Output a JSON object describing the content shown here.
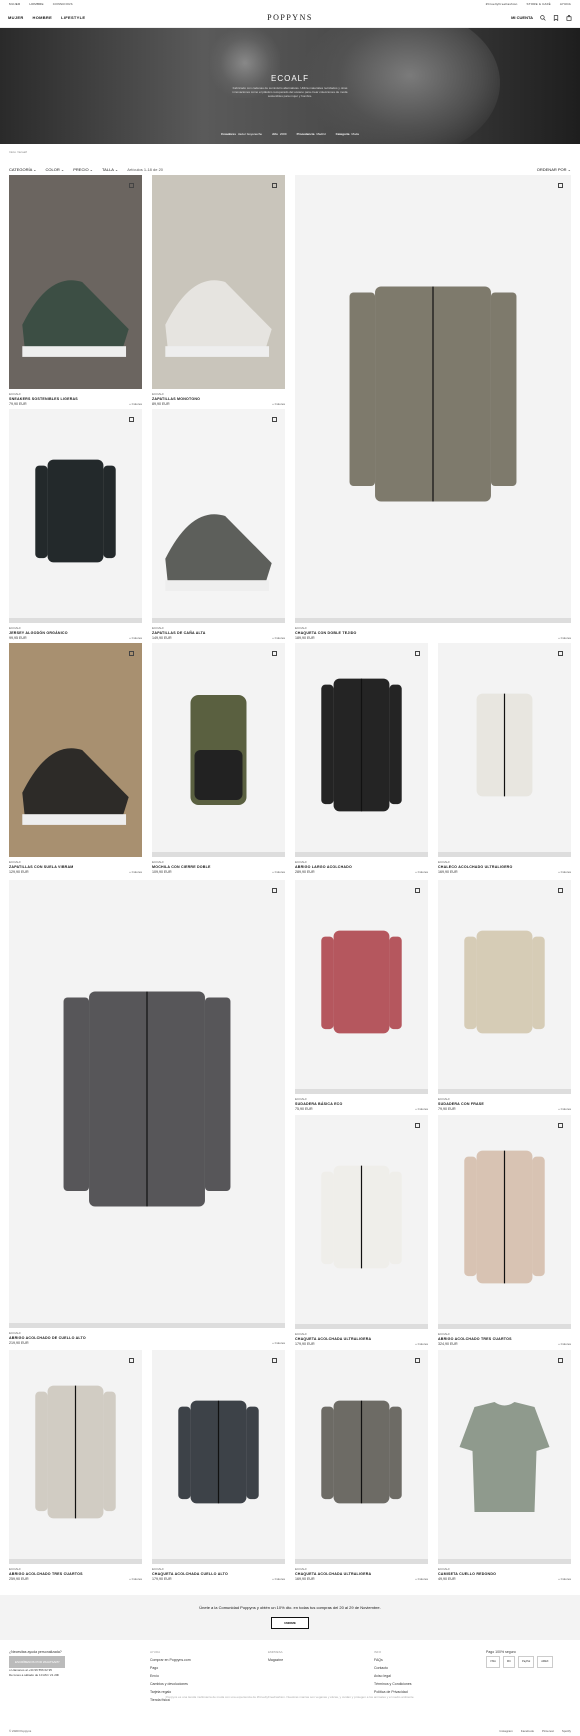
{
  "topbar": {
    "left": [
      "MUJER",
      "HOMBRE",
      "CONSCIOUS"
    ],
    "right": [
      "#CrueltyFreeFashion",
      "STORE & CAFÉ",
      "AYUDA"
    ]
  },
  "header": {
    "logo": "POPPYNS",
    "nav": [
      "MUJER",
      "HOMBRE",
      "LIFESTYLE"
    ],
    "account": "MI CUENTA"
  },
  "hero": {
    "title": "ECOALF",
    "text": "Fabricado con cadenas de suministro alternativas. Utiliza materiales reciclados y otras innovaciones como el plástico recuperado del océano para crear colecciones de moda sostenibles para mujer y hombre.",
    "meta": [
      {
        "k": "Creadores",
        "v": "Javier Goyeneche"
      },
      {
        "k": "Año",
        "v": "2009"
      },
      {
        "k": "Procedencia",
        "v": "Madrid"
      },
      {
        "k": "Categoría",
        "v": "Moda"
      }
    ]
  },
  "breadcrumb": "Inicio / Ecoalf",
  "filters": {
    "items": [
      "CATEGORÍA",
      "COLOR",
      "PRECIO",
      "TALLA"
    ],
    "count": "Artículos 1-18 de 20",
    "sort": "ORDENAR POR"
  },
  "products": [
    {
      "brand": "ECOALF",
      "name": "SNEAKERS SOSTENIBLES LIGERAS",
      "price": "79,90 EUR",
      "colors": "+ Colores"
    },
    {
      "brand": "ECOALF",
      "name": "ZAPATILLAS MONOTONO",
      "price": "89,90 EUR",
      "colors": "+ Colores"
    },
    {
      "brand": "ECOALF",
      "name": "CHAQUETA CON DOBLE TEJIDO",
      "price": "189,90 EUR",
      "colors": "+ Colores"
    },
    {
      "brand": "ECOALF",
      "name": "JERSEY ALGODÓN ORGÁNICO",
      "price": "99,95 EUR",
      "colors": "+ Colores"
    },
    {
      "brand": "ECOALF",
      "name": "ZAPATILLAS DE CAÑA ALTA",
      "price": "149,90 EUR",
      "colors": "+ Colores"
    },
    {
      "brand": "ECOALF",
      "name": "ZAPATILLAS CON SUELA VIBRAM",
      "price": "129,90 EUR",
      "colors": "+ Colores"
    },
    {
      "brand": "ECOALF",
      "name": "MOCHILA CON CIERRE DOBLE",
      "price": "109,90 EUR",
      "colors": "+ Colores"
    },
    {
      "brand": "ECOALF",
      "name": "ABRIGO LARGO ACOLCHADO",
      "price": "289,90 EUR",
      "colors": "+ Colores"
    },
    {
      "brand": "ECOALF",
      "name": "CHALECO ACOLCHADO ULTRALIGERO",
      "price": "169,90 EUR",
      "colors": "+ Colores"
    },
    {
      "brand": "ECOALF",
      "name": "ABRIGO ACOLCHADO DE CUELLO ALTO",
      "price": "219,90 EUR",
      "colors": "+ Colores"
    },
    {
      "brand": "ECOALF",
      "name": "SUDADERA BÁSICA ECO",
      "price": "75,90 EUR",
      "colors": "+ Colores"
    },
    {
      "brand": "ECOALF",
      "name": "SUDADERA CON FRASE",
      "price": "79,90 EUR",
      "colors": "+ Colores"
    },
    {
      "brand": "ECOALF",
      "name": "CHAQUETA ACOLCHADA ULTRALIGERA",
      "price": "179,90 EUR",
      "colors": "+ Colores"
    },
    {
      "brand": "ECOALF",
      "name": "ABRIGO ACOLCHADO TRES CUARTOS",
      "price": "324,90 EUR",
      "colors": "+ Colores"
    },
    {
      "brand": "ECOALF",
      "name": "ABRIGO ACOLCHADO TRES CUARTOS",
      "price": "259,90 EUR",
      "colors": "+ Colores"
    },
    {
      "brand": "ECOALF",
      "name": "CHAQUETA ACOLCHADA CUELLO ALTO",
      "price": "179,90 EUR",
      "colors": "+ Colores"
    },
    {
      "brand": "ECOALF",
      "name": "CHAQUETA ACOLCHADA ULTRALIGERA",
      "price": "169,90 EUR",
      "colors": "+ Colores"
    },
    {
      "brand": "ECOALF",
      "name": "CAMISETA CUELLO REDONDO",
      "price": "49,90 EUR",
      "colors": "+ Colores"
    }
  ],
  "newsletter": {
    "text": "Únete a la Comunidad Poppyns y obtén un 10% dto. en todas tus compras del 20 al 29 de Noviembre.",
    "button": "UNIRME"
  },
  "footer": {
    "help_title": "¿Necesitas ayuda personalizada?",
    "contact_button": "ESCRÍBENOS POR WHATSAPP",
    "phone": "o Llámanos al +34 96 556 02 95",
    "hours": "De lunes a sábado de 10 AM / 21 20h",
    "col1_title": "AYUDA",
    "col1": [
      "Comprar en Poppyns.com",
      "Pago",
      "Envío",
      "Cambios y devoluciones",
      "Tarjeta regalo",
      "Tienda física"
    ],
    "col2_title": "EMPRESA",
    "col2": [
      "Magazine"
    ],
    "col3_title": "INFO",
    "col3": [
      "FAQs",
      "Contacto",
      "Aviso legal",
      "Términos y Condiciones",
      "Política de Privacidad"
    ],
    "pay_title": "Pago 100% seguro",
    "pay": [
      "VISA",
      "MC",
      "PayPal",
      "AMEX"
    ],
    "note": "Poppyns es una tienda multimarca de moda con una experiencia de #CrueltyFreeFashion. Nuestras marcas son veganas y éticas, y cuidan y protegen a los animales y el medio ambiente.",
    "copyright": "© 2020 Poppyns",
    "social": [
      "Instagram",
      "Facebook",
      "Pinterest",
      "Spotify"
    ]
  },
  "colors": {
    "accent": "#111111",
    "strip": "#dddddd",
    "bg": "#f3f3f3"
  }
}
